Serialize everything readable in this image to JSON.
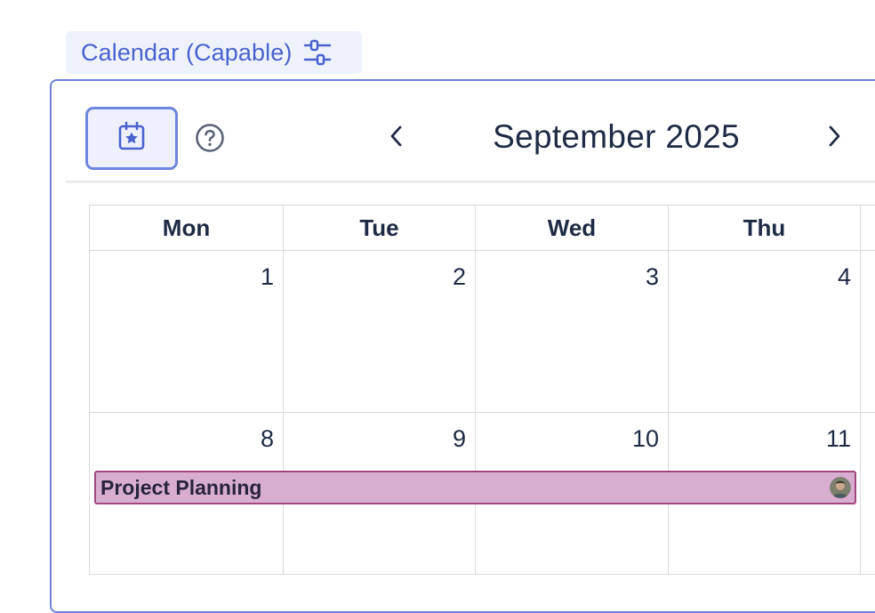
{
  "chip": {
    "label": "Calendar (Capable)",
    "icon": "sliders-icon"
  },
  "toolbar": {
    "calendar_button_icon": "calendar-star-icon",
    "help_icon": "help-circle-icon",
    "prev_icon": "chevron-left-icon",
    "next_icon": "chevron-right-icon",
    "month_title": "September 2025"
  },
  "grid": {
    "headers": [
      "Mon",
      "Tue",
      "Wed",
      "Thu"
    ],
    "weeks": [
      [
        "1",
        "2",
        "3",
        "4"
      ],
      [
        "8",
        "9",
        "10",
        "11"
      ]
    ]
  },
  "event": {
    "title": "Project Planning",
    "color": "#d8aed0",
    "border_color": "#a3467f",
    "avatar": "user-avatar"
  },
  "colors": {
    "accent": "#4a63cf",
    "panel_border": "#6f82d7",
    "text": "#1f2a44",
    "grid_line": "#d8d9dd"
  }
}
